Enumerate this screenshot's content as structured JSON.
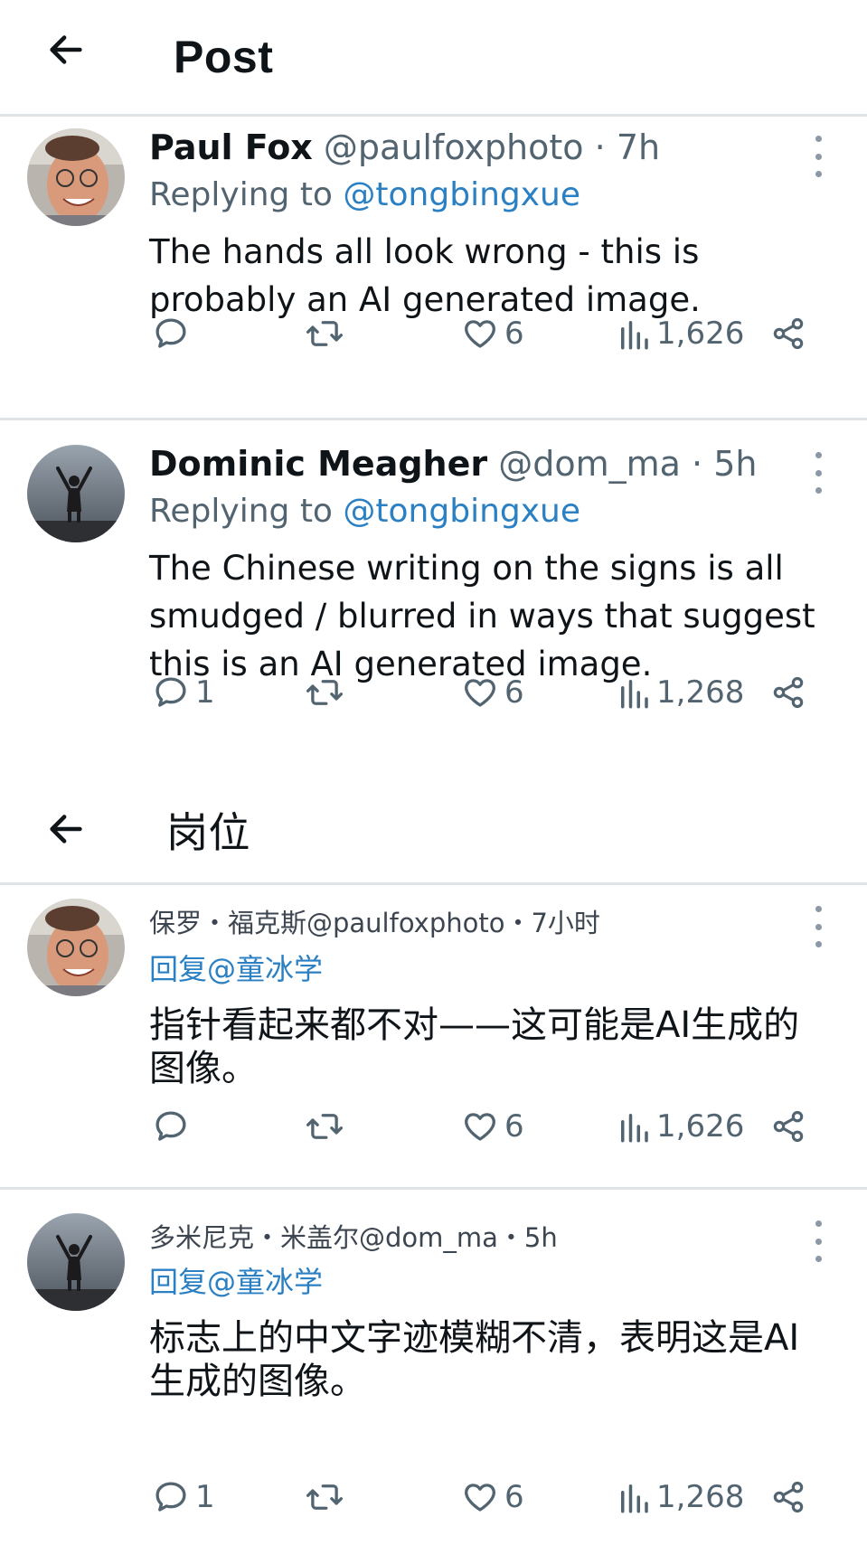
{
  "header_en": {
    "title": "Post"
  },
  "header_cn": {
    "title": "岗位"
  },
  "posts": [
    {
      "name": "Paul Fox",
      "handle": "@paulfoxphoto",
      "separator": "·",
      "time": "7h",
      "replying_prefix": "Replying to ",
      "replying_handle": "@tongbingxue",
      "text": "The hands all look wrong - this is probably an AI generated image.",
      "replies": "",
      "likes": "6",
      "views": "1,626"
    },
    {
      "name": "Dominic Meagher",
      "handle": "@dom_ma",
      "separator": "·",
      "time": "5h",
      "replying_prefix": "Replying to ",
      "replying_handle": "@tongbingxue",
      "text": "The Chinese writing on the signs is all smudged / blurred in ways that suggest this is an AI generated image.",
      "replies": "1",
      "likes": "6",
      "views": "1,268"
    },
    {
      "meta": "保罗・福克斯@paulfoxphoto・7小时",
      "replying": "回复@童冰学",
      "text": "指针看起来都不对——这可能是AI生成的图像。",
      "replies": "",
      "likes": "6",
      "views": "1,626"
    },
    {
      "meta": "多米尼克・米盖尔@dom_ma・5h",
      "replying": "回复@童冰学",
      "text": "标志上的中文字迹模糊不清，表明这是AI生成的图像。",
      "replies": "1",
      "likes": "6",
      "views": "1,268"
    }
  ],
  "icons": {
    "back": "arrow-left-icon",
    "more": "more-vertical-icon",
    "reply": "speech-bubble-icon",
    "retweet": "retweet-icon",
    "like": "heart-icon",
    "views": "bar-chart-icon",
    "share": "share-icon"
  },
  "colors": {
    "text": "#0f1419",
    "secondary": "#536471",
    "link": "#2b80c3",
    "divider": "#dfe3e6"
  }
}
